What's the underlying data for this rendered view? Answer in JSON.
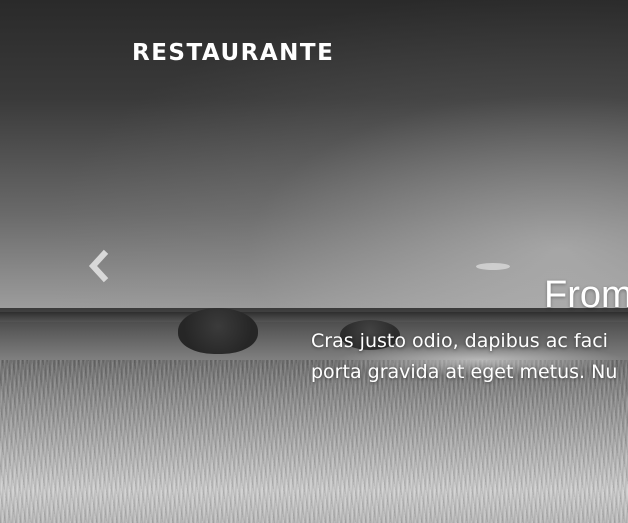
{
  "header": {
    "logo_text": "RESTAURANTE"
  },
  "slider": {
    "prev_icon": "chevron-left-icon",
    "slide": {
      "title": "From",
      "text_line_1": "Cras justo odio, dapibus ac faci",
      "text_line_2": "porta gravida at eget metus. Nu"
    }
  },
  "colors": {
    "text": "#ffffff",
    "image_tone": "grayscale"
  }
}
